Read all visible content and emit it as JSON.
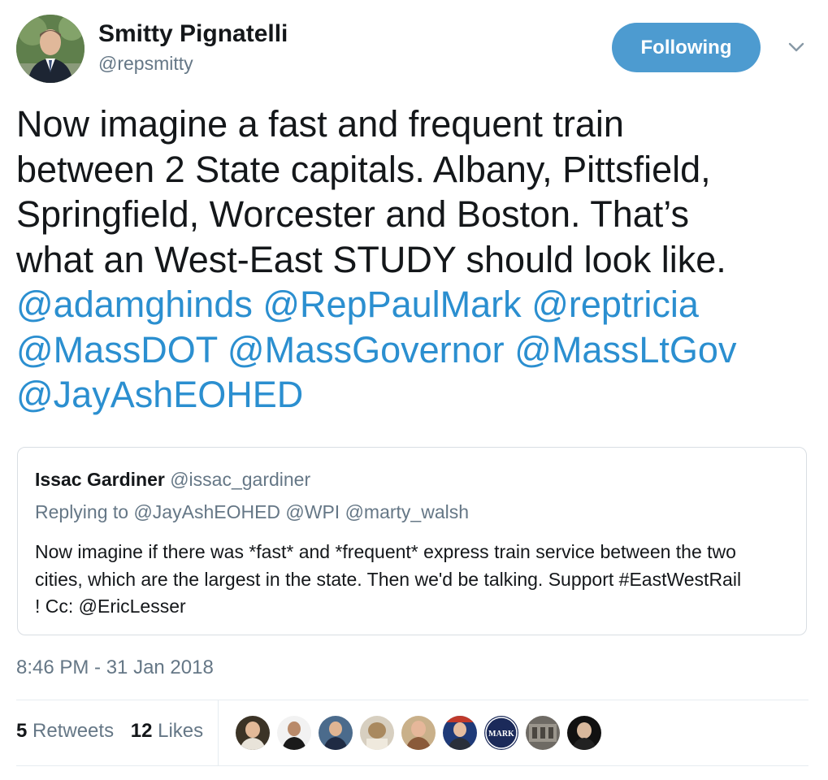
{
  "author": {
    "name": "Smitty Pignatelli",
    "handle": "@repsmitty",
    "follow_label": "Following"
  },
  "tweet": {
    "lines": [
      "Now imagine a fast and frequent train",
      "between 2 State capitals. Albany, Pittsfield,",
      "Springfield, Worcester and Boston. That’s",
      "what an West-East STUDY should look like."
    ],
    "mentions": [
      [
        "@adamghinds",
        "@RepPaulMark",
        "@reptricia"
      ],
      [
        "@MassDOT",
        "@MassGovernor",
        "@MassLtGov"
      ],
      [
        "@JayAshEOHED"
      ]
    ]
  },
  "quoted": {
    "name": "Issac Gardiner",
    "handle": "@issac_gardiner",
    "replying_to": "Replying to @JayAshEOHED @WPI @marty_walsh",
    "text_lines": [
      "Now imagine if there was *fast* and *frequent* express train service between the two",
      "cities, which are the largest in the state. Then we'd be talking. Support #EastWestRail",
      "! Cc: @EricLesser"
    ]
  },
  "timestamp": "8:46 PM - 31 Jan 2018",
  "stats": {
    "retweets_count": "5",
    "retweets_label": "Retweets",
    "likes_count": "12",
    "likes_label": "Likes"
  },
  "likers_badge_text": "MARK",
  "colors": {
    "accent": "#4d9bd0",
    "mention": "#2b8fd0",
    "muted": "#657786",
    "text": "#14171a"
  }
}
